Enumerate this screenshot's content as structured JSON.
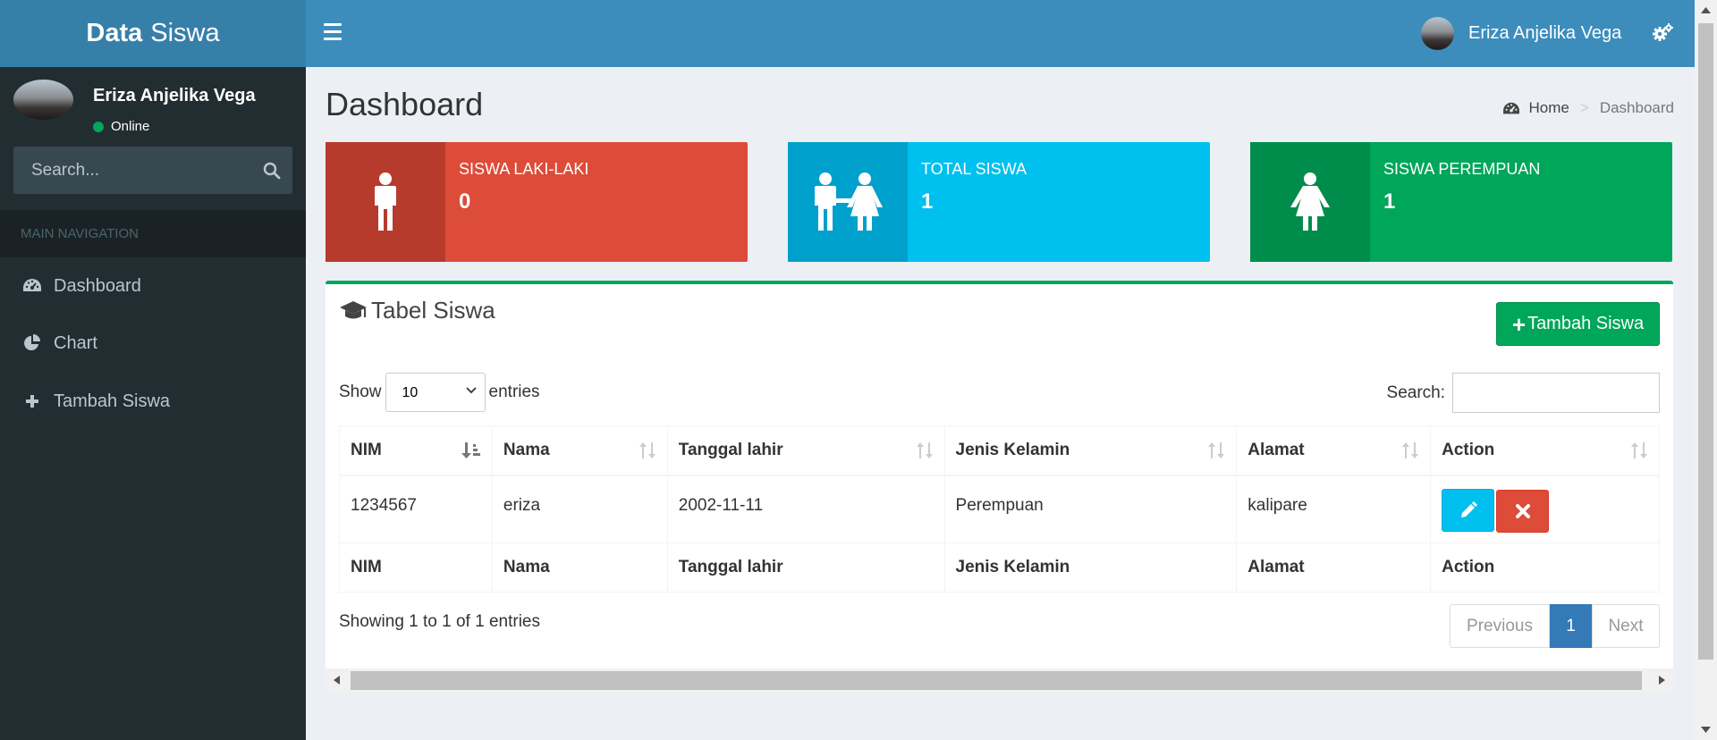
{
  "app": {
    "logo_bold": "Data",
    "logo_light": "Siswa"
  },
  "sidebar": {
    "user_name": "Eriza Anjelika Vega",
    "status": "Online",
    "search_placeholder": "Search...",
    "nav_header": "MAIN NAVIGATION",
    "items": [
      {
        "label": "Dashboard",
        "icon": "dashboard-icon"
      },
      {
        "label": "Chart",
        "icon": "pie-chart-icon"
      },
      {
        "label": "Tambah Siswa",
        "icon": "plus-icon"
      }
    ]
  },
  "navbar": {
    "user_name": "Eriza Anjelika Vega"
  },
  "page": {
    "title": "Dashboard",
    "breadcrumb": [
      "Home",
      "Dashboard"
    ]
  },
  "stats": [
    {
      "label": "SISWA LAKI-LAKI",
      "value": "0",
      "color": "#dd4b39",
      "icon_bg": "#b73b2d",
      "icon": "male-icon"
    },
    {
      "label": "TOTAL SISWA",
      "value": "1",
      "color": "#00c0ef",
      "icon_bg": "#00a0cc",
      "icon": "couple-icon"
    },
    {
      "label": "SISWA PEREMPUAN",
      "value": "1",
      "color": "#00a65a",
      "icon_bg": "#008d4c",
      "icon": "female-icon"
    }
  ],
  "table_box": {
    "title": "Tabel Siswa",
    "add_button": "Tambah Siswa",
    "show_label": "Show",
    "entries_label": "entries",
    "page_size": "10",
    "search_label": "Search:",
    "columns": [
      "NIM",
      "Nama",
      "Tanggal lahir",
      "Jenis Kelamin",
      "Alamat",
      "Action"
    ],
    "rows": [
      {
        "nim": "1234567",
        "nama": "eriza",
        "tanggal_lahir": "2002-11-11",
        "jenis_kelamin": "Perempuan",
        "alamat": "kalipare"
      }
    ],
    "info": "Showing 1 to 1 of 1 entries",
    "pagination": {
      "previous": "Previous",
      "current": "1",
      "next": "Next"
    }
  }
}
